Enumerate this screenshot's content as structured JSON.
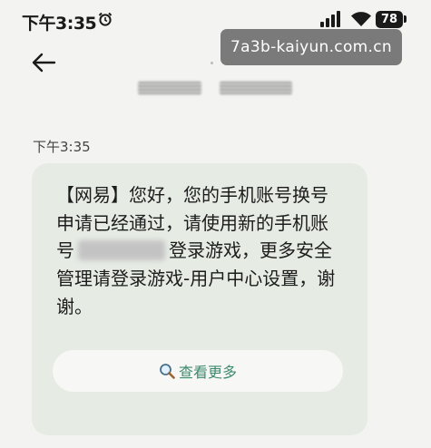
{
  "status": {
    "time": "下午3:35",
    "battery": "78"
  },
  "watermark": {
    "text": "7a3b-kaiyun.com.cn"
  },
  "message": {
    "timestamp": "下午3:35",
    "lines": [
      "【网易】您好，您的手机账号换号",
      "申请已经通过，请使用新的手机账",
      "号",
      "登录游戏，更多安全",
      "管理请登录游戏-用户中心设置，谢",
      "谢。"
    ]
  },
  "actions": {
    "more_label": "查看更多"
  },
  "icons": {
    "back": "back-arrow-icon",
    "search": "search-icon",
    "alarm": "alarm-icon",
    "signal": "signal-icon",
    "wifi": "wifi-icon"
  },
  "colors": {
    "accent": "#3f8a6f",
    "bubble": "#e6ebe4",
    "background": "#f3f4f2"
  }
}
